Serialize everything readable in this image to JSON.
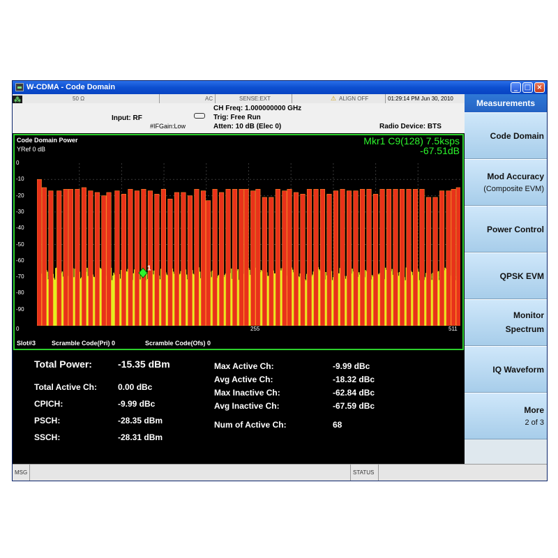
{
  "window": {
    "title": "W-CDMA - Code Domain",
    "colors": {
      "titlebar": "#0d4fd0",
      "graph_border": "#2ccf2c",
      "marker_text": "#2cf52c",
      "bar_active": "#e8321a",
      "bar_inactive": "#e6f01e",
      "background": "#000000"
    }
  },
  "status_bar": {
    "impedance": "50 Ω",
    "coupling": "AC",
    "sense": "SENSE:EXT",
    "align": "ALIGN OFF",
    "datetime": "01:29:14 PM Jun 30, 2010"
  },
  "info_bar": {
    "input": "Input: RF",
    "ifgain": "#IFGain:Low",
    "ch_freq": "CH Freq: 1.000000000 GHz",
    "trig": "Trig: Free Run",
    "atten": "Atten: 10 dB (Elec 0)",
    "radio_device": "Radio Device: BTS"
  },
  "graph": {
    "title": "Code Domain Power",
    "yref_label": "YRef",
    "yref_value": "0 dB",
    "marker_line1": "Mkr1 C9(128) 7.5ksps",
    "marker_line2": "-67.51dB",
    "marker_label": "1",
    "y_ticks": [
      "0",
      "-10",
      "-20",
      "-30",
      "-40",
      "-50",
      "-60",
      "-70",
      "-80",
      "-90"
    ],
    "x_ticks": [
      "0",
      "255",
      "511"
    ],
    "slot": "Slot#3",
    "scramble_pri": "Scramble Code(Pri) 0",
    "scramble_ofs": "Scramble Code(Ofs) 0"
  },
  "chart_data": {
    "type": "bar",
    "x_range": [
      0,
      511
    ],
    "ylim": [
      -100,
      0
    ],
    "active_channels_approx": [
      0,
      6,
      14,
      24,
      32,
      38,
      46,
      54,
      62,
      70,
      78,
      84,
      94,
      102,
      110,
      118,
      126,
      134,
      142,
      150,
      158,
      166,
      174,
      182,
      190,
      198,
      204,
      212,
      220,
      228,
      236,
      244,
      250,
      258,
      264,
      272,
      280,
      288,
      296,
      302,
      310,
      318,
      326,
      334,
      342,
      350,
      358,
      366,
      374,
      382,
      390,
      398,
      406,
      414,
      422,
      430,
      438,
      446,
      454,
      462,
      470,
      478,
      486,
      494,
      500,
      506
    ],
    "active_levels_db_approx": [
      -10,
      -15,
      -17,
      -17,
      -16,
      -16,
      -16,
      -15,
      -17,
      -18,
      -20,
      -18,
      -17,
      -19,
      -16,
      -17,
      -16,
      -17,
      -19,
      -16,
      -22,
      -18,
      -18,
      -20,
      -16,
      -17,
      -23,
      -16,
      -18,
      -16,
      -16,
      -16,
      -16,
      -17,
      -16,
      -21,
      -21,
      -16,
      -17,
      -16,
      -18,
      -19,
      -16,
      -16,
      -16,
      -19,
      -17,
      -16,
      -17,
      -17,
      -16,
      -16,
      -19,
      -16,
      -16,
      -16,
      -16,
      -16,
      -16,
      -16,
      -21,
      -21,
      -17,
      -17,
      -16,
      -15
    ],
    "inactive_floor_db_approx": -68,
    "marker": {
      "channel": 128,
      "value_db": -67.51
    }
  },
  "results": {
    "total_power_label": "Total Power:",
    "total_power_value": "-15.35 dBm",
    "total_active_label": "Total Active Ch:",
    "total_active_value": "0.00 dBc",
    "cpich_label": "CPICH:",
    "cpich_value": "-9.99 dBc",
    "psch_label": "PSCH:",
    "psch_value": "-28.35 dBm",
    "ssch_label": "SSCH:",
    "ssch_value": "-28.31 dBm",
    "max_active_label": "Max Active Ch:",
    "max_active_value": "-9.99 dBc",
    "avg_active_label": "Avg Active Ch:",
    "avg_active_value": "-18.32 dBc",
    "max_inactive_label": "Max Inactive Ch:",
    "max_inactive_value": "-62.84 dBc",
    "avg_inactive_label": "Avg Inactive Ch:",
    "avg_inactive_value": "-67.59 dBc",
    "num_active_label": "Num of Active Ch:",
    "num_active_value": "68"
  },
  "sidebar": {
    "header": "Measurements",
    "keys": [
      {
        "line1": "Code Domain",
        "line2": ""
      },
      {
        "line1": "Mod Accuracy",
        "line2": "(Composite EVM)"
      },
      {
        "line1": "Power Control",
        "line2": ""
      },
      {
        "line1": "QPSK EVM",
        "line2": ""
      },
      {
        "line1": "Monitor",
        "line2": "Spectrum"
      },
      {
        "line1": "IQ Waveform",
        "line2": ""
      },
      {
        "line1": "More",
        "line2": "2 of 3"
      }
    ]
  },
  "footer": {
    "msg": "MSG",
    "status": "STATUS"
  }
}
